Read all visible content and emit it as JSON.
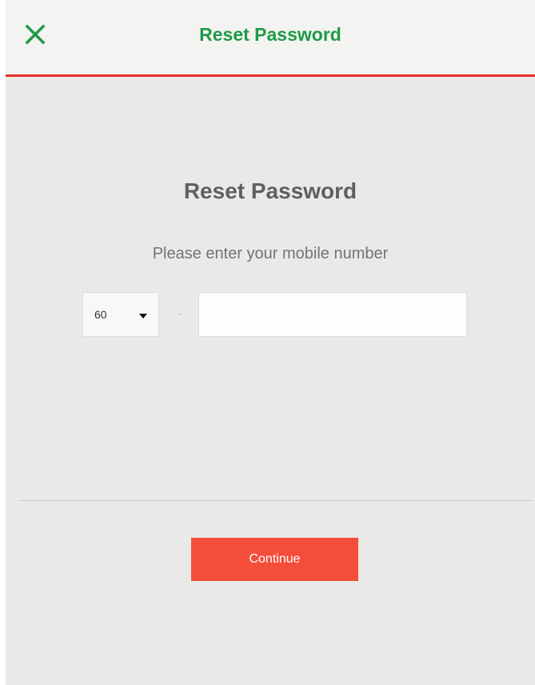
{
  "header": {
    "title": "Reset Password",
    "close_icon": "close-icon"
  },
  "main": {
    "title": "Reset Password",
    "subtitle": "Please enter your mobile number",
    "country_code": "60",
    "separator": "-",
    "phone_value": "",
    "phone_placeholder": "",
    "continue_label": "Continue"
  },
  "colors": {
    "accent_green": "#1f9a47",
    "header_border": "#e8322a",
    "button_bg": "#f44e3b",
    "body_bg": "#e9e9e7"
  }
}
